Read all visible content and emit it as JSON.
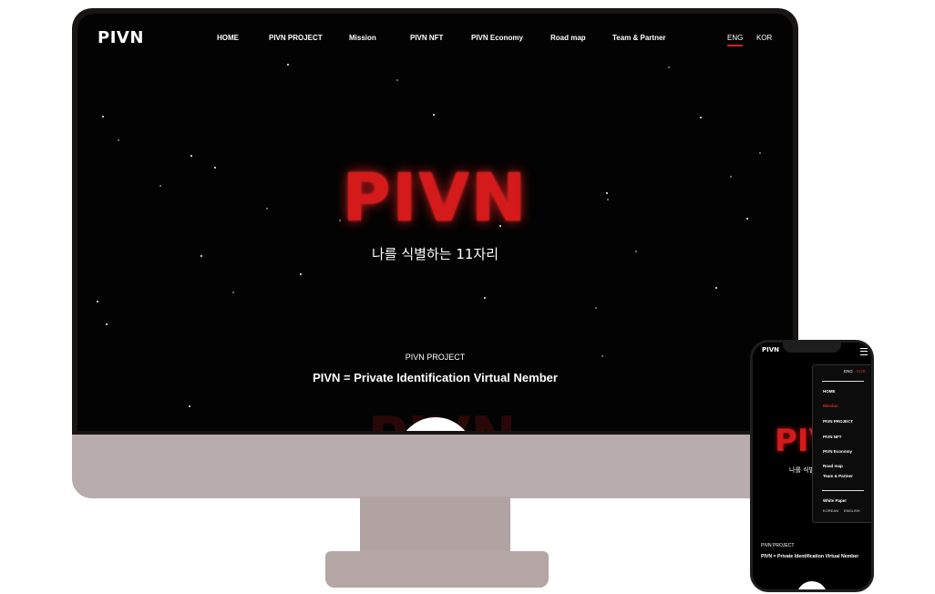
{
  "desktop": {
    "brand": "PIVN",
    "nav": [
      {
        "label": "HOME"
      },
      {
        "label": "PIVN PROJECT"
      },
      {
        "label": "Mission"
      },
      {
        "label": "PIVN NFT"
      },
      {
        "label": "PIVN Economy"
      },
      {
        "label": "Road map"
      },
      {
        "label": "Team & Partner"
      }
    ],
    "languages": {
      "eng": "ENG",
      "kor": "KOR",
      "active": "ENG"
    },
    "hero": {
      "logo": "PIVN",
      "subtitle": "나를 식별하는 11자리"
    },
    "project": {
      "label": "PIVN PROJECT",
      "title": "PIVN = Private Identification Virtual Nember"
    },
    "background_text": "PIVN"
  },
  "mobile": {
    "brand": "PIVN",
    "hero_logo": "PIVN",
    "hero_subtitle": "나를 식별하는 11자리",
    "menu": {
      "languages": {
        "eng": "ENG",
        "kor": "KOR",
        "active": "KOR"
      },
      "items": [
        {
          "label": "HOME",
          "active": false
        },
        {
          "label": "Mission",
          "active": true
        },
        {
          "label": "PIVN PROJECT",
          "active": false
        },
        {
          "label": "PIVN NFT",
          "active": false
        },
        {
          "label": "PIVN Economy",
          "active": false
        },
        {
          "label": "Road map",
          "active": false
        },
        {
          "label": "Team & Partner",
          "active": false
        }
      ],
      "white_paper": "White Paper",
      "paper_korean": "KOREAN",
      "paper_english": "ENGLISH"
    },
    "project": {
      "label": "PIVN PROJECT",
      "title": "PIVN = Private Identification Virtual Nember"
    }
  },
  "colors": {
    "accent": "#d41a1a",
    "background": "#030303",
    "monitor_frame": "#b9acac"
  }
}
